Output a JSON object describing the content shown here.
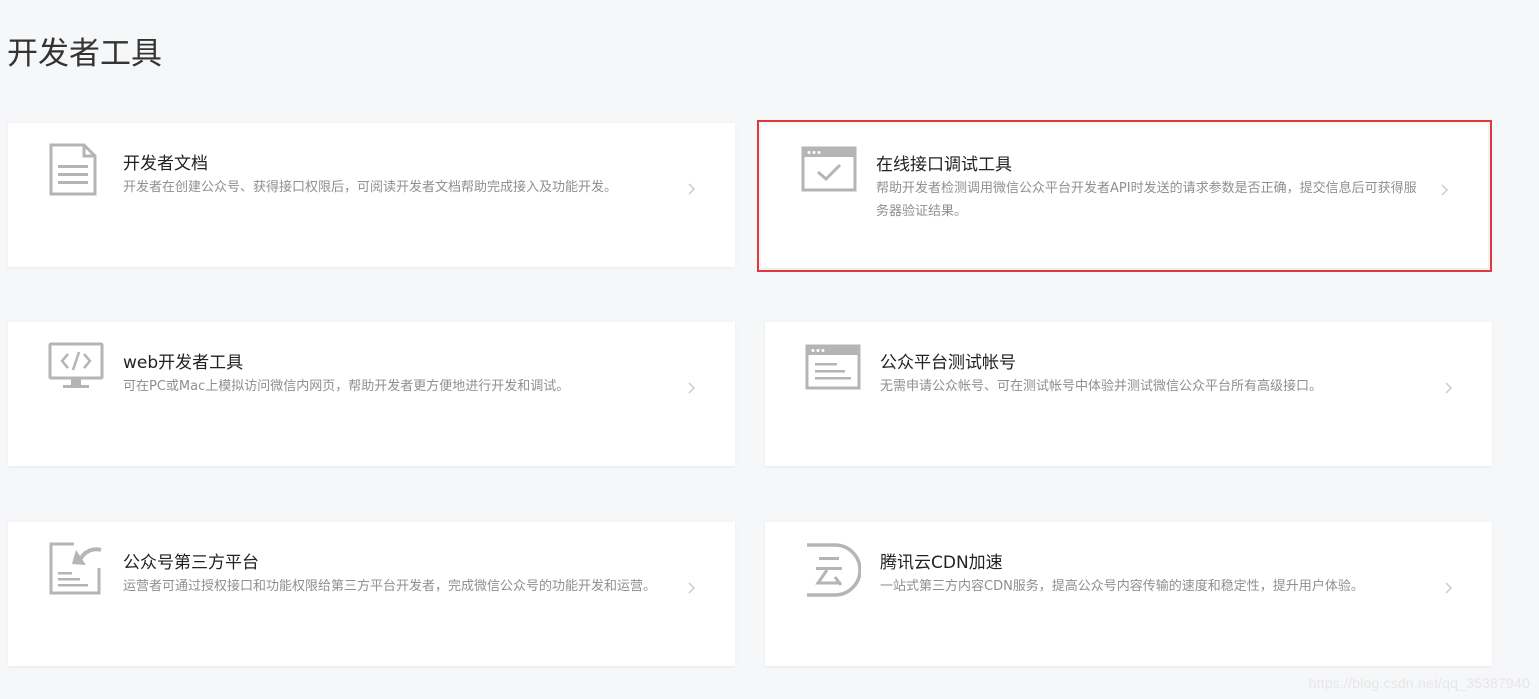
{
  "page": {
    "title": "开发者工具"
  },
  "cards": [
    {
      "title": "开发者文档",
      "description": "开发者在创建公众号、获得接口权限后，可阅读开发者文档帮助完成接入及功能开发。",
      "icon": "document-icon"
    },
    {
      "title": "在线接口调试工具",
      "description": "帮助开发者检测调用微信公众平台开发者API时发送的请求参数是否正确，提交信息后可获得服务器验证结果。",
      "icon": "browser-check-icon",
      "highlighted": true
    },
    {
      "title": "web开发者工具",
      "description": "可在PC或Mac上模拟访问微信内网页，帮助开发者更方便地进行开发和调试。",
      "icon": "monitor-code-icon"
    },
    {
      "title": "公众平台测试帐号",
      "description": "无需申请公众帐号、可在测试帐号中体验并测试微信公众平台所有高级接口。",
      "icon": "browser-text-icon"
    },
    {
      "title": "公众号第三方平台",
      "description": "运营者可通过授权接口和功能权限给第三方平台开发者，完成微信公众号的功能开发和运营。",
      "icon": "document-share-icon"
    },
    {
      "title": "腾讯云CDN加速",
      "description": "一站式第三方内容CDN服务，提高公众号内容传输的速度和稳定性，提升用户体验。",
      "icon": "tencent-cloud-icon"
    }
  ],
  "watermark": "https://blog.csdn.net/qq_35387940",
  "colors": {
    "background": "#f6f7f9",
    "card": "#ffffff",
    "icon": "#b5b5b5",
    "highlight_border": "#e0383e",
    "title_text": "#222222",
    "desc_text": "#8f8f8f"
  }
}
